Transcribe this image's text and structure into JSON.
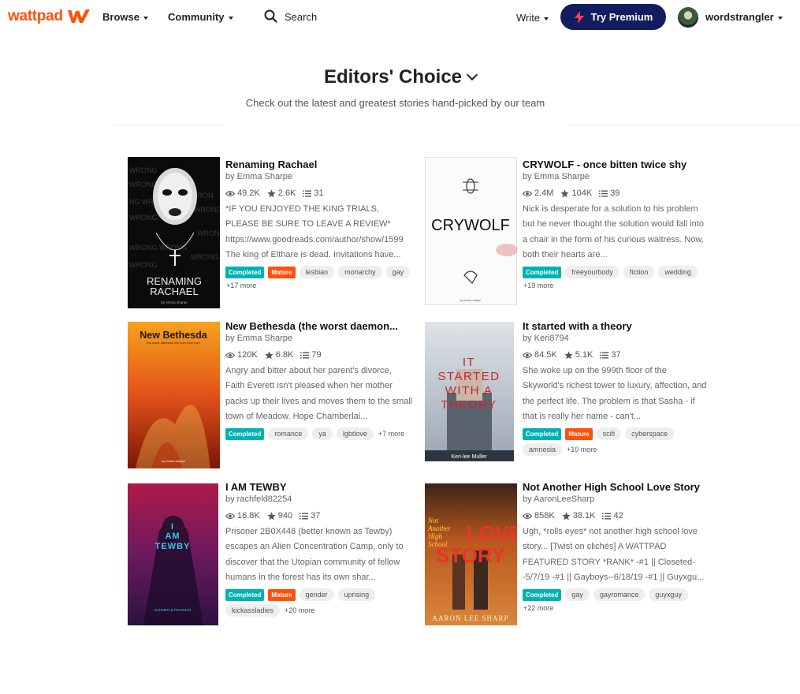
{
  "header": {
    "logo_text": "wattpad",
    "browse": "Browse",
    "community": "Community",
    "search": "Search",
    "write": "Write",
    "premium": "Try Premium",
    "username": "wordstrangler"
  },
  "page": {
    "title": "Editors' Choice",
    "subtitle": "Check out the latest and greatest stories hand-picked by our team"
  },
  "colors": {
    "brand": "#ff500a",
    "premium_bg": "#121d60",
    "completed": "#00b2b2",
    "mature": "#ff500a"
  },
  "stories": [
    {
      "title": "Renaming Rachael",
      "author": "by Emma Sharpe",
      "reads": "49.2K",
      "votes": "2.6K",
      "parts": "31",
      "description": "*IF YOU ENJOYED THE KING TRIALS, PLEASE BE SURE TO LEAVE A REVIEW* https://www.goodreads.com/author/show/1599 The king of Elthare is dead. Invitations have...",
      "completed": "Completed",
      "mature": "Mature",
      "tags": [
        "lesbian",
        "monarchy",
        "gay"
      ],
      "more": "+17 more",
      "cover_title_1": "RENAMING",
      "cover_title_2": "RACHAEL",
      "cover_author": "by emma sharpe"
    },
    {
      "title": "CRYWOLF - once bitten twice shy",
      "author": "by Emma Sharpe",
      "reads": "2.4M",
      "votes": "104K",
      "parts": "39",
      "description": "Nick is desperate for a solution to his problem but he never thought the solution would fall into a chair in the form of his curious waitress. Now, both their hearts are...",
      "completed": "Completed",
      "mature": "",
      "tags": [
        "freeyourbody",
        "fiction",
        "wedding"
      ],
      "more": "+19 more",
      "cover_title_1": "CRYWOLF",
      "cover_title_2": "",
      "cover_author": "by emma sharpe"
    },
    {
      "title": "New Bethesda (the worst daemon...",
      "author": "by Emma Sharpe",
      "reads": "120K",
      "votes": "6.8K",
      "parts": "79",
      "description": "Angry and bitter about her parent's divorce, Faith Everett isn't pleased when her mother packs up their lives and moves them to the small town of Meadow. Hope Chamberlai...",
      "completed": "Completed",
      "mature": "",
      "tags": [
        "romance",
        "ya",
        "lgbtlove"
      ],
      "more": "+7 more",
      "cover_title_1": "New Bethesda",
      "cover_title_2": "the worst daemons are born from love",
      "cover_author": "by emma sharpe"
    },
    {
      "title": "It started with a theory",
      "author": "by Keri8794",
      "reads": "84.5K",
      "votes": "5.1K",
      "parts": "37",
      "description": "She woke up on the 999th floor of the Skyworld's richest tower to luxury, affection, and the perfect life. The problem is that Sasha - if that is really her name - can't...",
      "completed": "Completed",
      "mature": "Mature",
      "tags": [
        "scifi",
        "cyberspace",
        "amnesia"
      ],
      "more": "+10 more",
      "cover_title_1": "IT STARTED WITH A THEORY",
      "cover_title_2": "",
      "cover_author": "Keri-lee Muller"
    },
    {
      "title": "I AM TEWBY",
      "author": "by rachfeld82254",
      "reads": "16.8K",
      "votes": "940",
      "parts": "37",
      "description": "Prisoner 2B0X448 (better known as Tewby) escapes an Alien Concentration Camp, only to discover that the Utopian community of fellow humans in the forest has its own shar...",
      "completed": "Completed",
      "mature": "Mature",
      "tags": [
        "gender",
        "uprising",
        "kickassladies"
      ],
      "more": "+20 more",
      "cover_title_1": "I AM TEWBY",
      "cover_title_2": "",
      "cover_author": "DAHMEN & FELDMAN"
    },
    {
      "title": "Not Another High School Love Story",
      "author": "by AaronLeeSharp",
      "reads": "858K",
      "votes": "38.1K",
      "parts": "42",
      "description": "Ugh, *rolls eyes* not another high school love story... [Twist on clichés] A WATTPAD FEATURED STORY *RANK* -#1 || Closeted- -5/7/19 -#1 || Gayboys--6/18/19 -#1 || Guyxgu...",
      "completed": "Completed",
      "mature": "",
      "tags": [
        "gay",
        "gayromance",
        "guyxguy"
      ],
      "more": "+22 more",
      "cover_title_1": "LOVE STORY",
      "cover_title_2": "Not Another High School",
      "cover_author": "AARON LEE SHARP"
    }
  ]
}
